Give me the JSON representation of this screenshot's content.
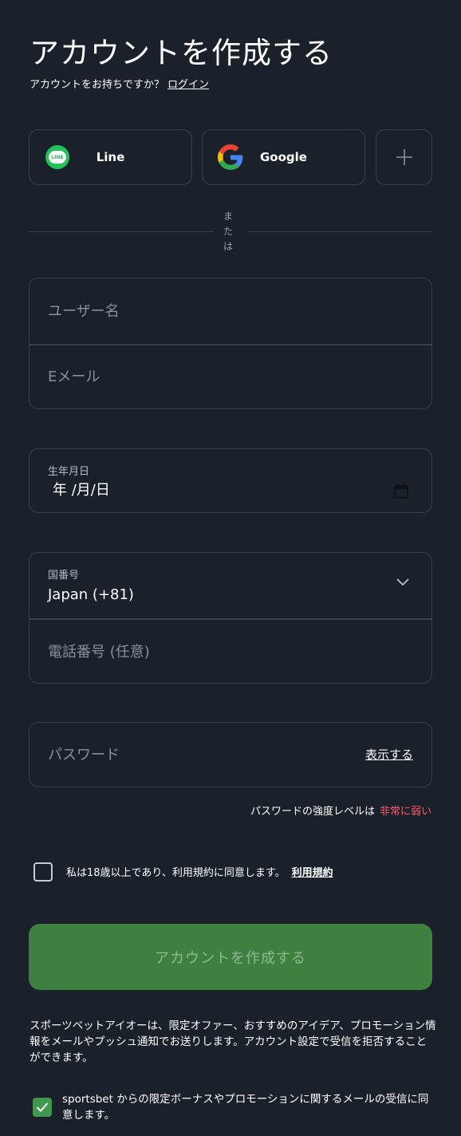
{
  "header": {
    "title": "アカウントを作成する",
    "subtitle": "アカウントをお持ちですか？",
    "login_link": "ログイン"
  },
  "social": {
    "line_label": "Line",
    "line_icon_text": "LINE",
    "google_label": "Google"
  },
  "divider": {
    "or_text": [
      "ま",
      "た",
      "は"
    ]
  },
  "form": {
    "username_placeholder": "ユーザー名",
    "email_placeholder": "Eメール",
    "dob_label": "生年月日",
    "dob_value": "年 /月/日",
    "country_label": "国番号",
    "country_value": "Japan (+81)",
    "phone_placeholder": "電話番号 (任意)",
    "password_placeholder": "パスワード",
    "show_password": "表示する",
    "strength_label": "パスワードの強度レベルは",
    "strength_value": "非常に弱い"
  },
  "terms": {
    "text": "私は18歳以上であり、利用規約に同意します。",
    "link": "利用規約",
    "checked": false
  },
  "actions": {
    "create_button": "アカウントを作成する"
  },
  "info": {
    "text": "スポーツベットアイオーは、限定オファー、おすすめのアイデア、プロモーション情報をメールやプッシュ通知でお送りします。アカウント設定で受信を拒否することができます。"
  },
  "marketing": {
    "text": "sportsbet からの限定ボーナスやプロモーションに関するメールの受信に同意します。",
    "checked": true
  },
  "colors": {
    "background": "#1b212a",
    "border": "#3a414b",
    "primary_button": "#3f8040",
    "weak_strength": "#ff5a6e",
    "checkbox_checked": "#3f9a4c"
  }
}
